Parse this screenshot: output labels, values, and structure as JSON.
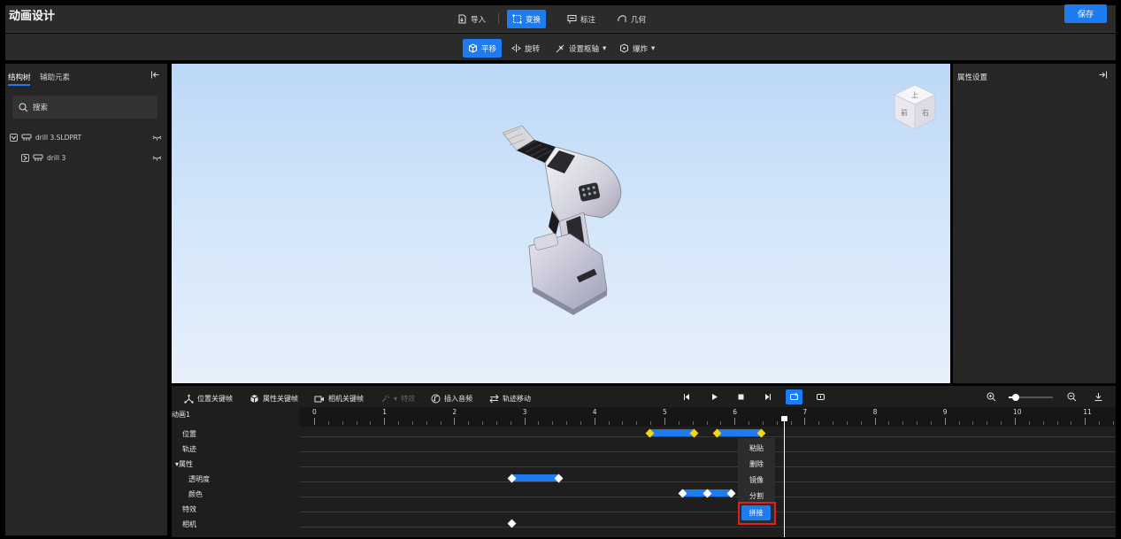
{
  "app": {
    "title": "动画设计",
    "save_label": "保存"
  },
  "toolbar": {
    "items": [
      {
        "label": "导入",
        "icon": "import-icon",
        "active": false
      },
      {
        "label": "变换",
        "icon": "transform-icon",
        "active": true
      },
      {
        "label": "标注",
        "icon": "annotate-icon",
        "active": false
      },
      {
        "label": "几何",
        "icon": "geometry-icon",
        "active": false
      }
    ]
  },
  "subtoolbar": {
    "items": [
      {
        "label": "平移",
        "icon": "translate-icon",
        "active": true
      },
      {
        "label": "旋转",
        "icon": "rotate-icon",
        "active": false
      },
      {
        "label": "设置枢轴",
        "icon": "pivot-icon",
        "dropdown": true
      },
      {
        "label": "爆炸",
        "icon": "explode-icon",
        "dropdown": true
      }
    ]
  },
  "left_panel": {
    "tabs": [
      "结构树",
      "辅助元素"
    ],
    "search_placeholder": "搜索",
    "tree": [
      {
        "label": "drill 3.SLDPRT",
        "level": 0
      },
      {
        "label": "drill 3",
        "level": 1
      }
    ]
  },
  "right_panel": {
    "title": "属性设置"
  },
  "viewcube": {
    "top_face": "上",
    "front_face": "前",
    "right_face": "右"
  },
  "timeline": {
    "tools": [
      {
        "label": "位置关键帧",
        "icon": "position-keyframe-icon",
        "enabled": true
      },
      {
        "label": "属性关键帧",
        "icon": "property-keyframe-icon",
        "enabled": true
      },
      {
        "label": "相机关键帧",
        "icon": "camera-keyframe-icon",
        "enabled": true
      },
      {
        "label": "特效",
        "icon": "effect-icon",
        "enabled": false
      },
      {
        "label": "插入音频",
        "icon": "audio-icon",
        "enabled": true
      },
      {
        "label": "轨迹移动",
        "icon": "track-move-icon",
        "enabled": true
      }
    ],
    "animation_name": "动画1",
    "ticks": [
      "0",
      "1",
      "2",
      "3",
      "4",
      "5",
      "6",
      "7",
      "8",
      "9",
      "10",
      "11"
    ],
    "playhead_time": 6.7,
    "tracks": [
      {
        "label": "位置",
        "indent": 1
      },
      {
        "label": "轨迹",
        "indent": 1
      },
      {
        "label": "属性",
        "indent": 0,
        "expanded": true
      },
      {
        "label": "透明度",
        "indent": 2
      },
      {
        "label": "颜色",
        "indent": 2
      },
      {
        "label": "特效",
        "indent": 1
      },
      {
        "label": "相机",
        "indent": 1
      }
    ]
  },
  "context_menu": {
    "items": [
      "粘贴",
      "删除",
      "镜像",
      "分割",
      "拼接"
    ],
    "highlighted": "拼接"
  },
  "colors": {
    "accent": "#1f7cf0",
    "keyframe_selected": "#ffd400",
    "highlight_border": "#e02020"
  }
}
